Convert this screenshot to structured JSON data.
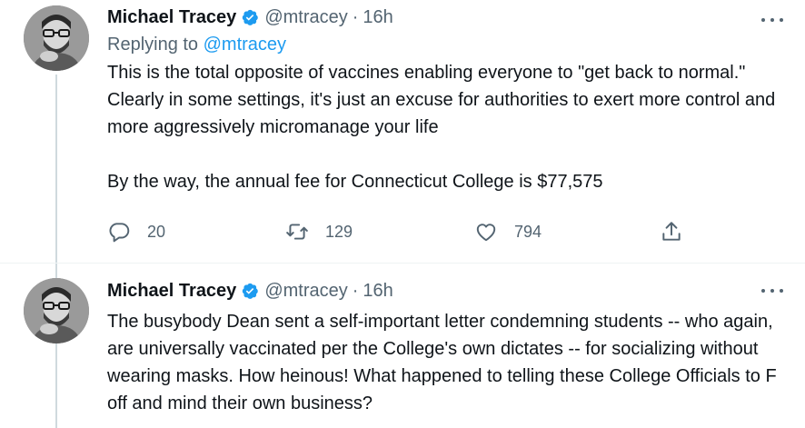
{
  "tweets": [
    {
      "author_name": "Michael Tracey",
      "handle": "@mtracey",
      "separator": "·",
      "time": "16h",
      "replying_prefix": "Replying to",
      "replying_to": "@mtracey",
      "text": "This is the total opposite of vaccines enabling everyone to \"get back to normal.\" Clearly in some settings, it's just an excuse for authorities to exert more control and more aggressively micromanage your life\n\nBy the way, the annual fee for Connecticut College is $77,575",
      "reply_count": "20",
      "retweet_count": "129",
      "like_count": "794"
    },
    {
      "author_name": "Michael Tracey",
      "handle": "@mtracey",
      "separator": "·",
      "time": "16h",
      "text": "The busybody Dean sent a self-important letter condemning students -- who again, are universally vaccinated per the College's own dictates -- for socializing without wearing masks. How heinous! What happened to telling these College Officials to F off and mind their own business?"
    }
  ],
  "colors": {
    "verified_badge": "#1d9bf0",
    "link": "#1d9bf0",
    "secondary_text": "#536471",
    "thread_line": "#cfd9de"
  },
  "icons": [
    "verified-badge-icon",
    "more-options-icon",
    "reply-icon",
    "retweet-icon",
    "like-icon",
    "share-icon"
  ]
}
